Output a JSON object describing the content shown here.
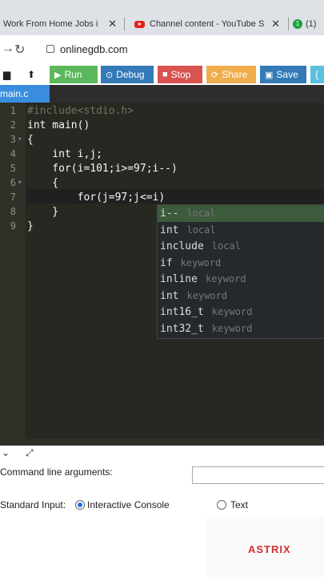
{
  "browser": {
    "tabs": [
      {
        "label": "Work From Home Jobs i"
      },
      {
        "label": "Channel content - YouTube S"
      },
      {
        "label": "(1)"
      }
    ],
    "url": "onlinegdb.com"
  },
  "toolbar": {
    "run": "Run",
    "debug": "Debug",
    "stop": "Stop",
    "share": "Share",
    "save": "Save",
    "extra": "{"
  },
  "file_tab": "main.c",
  "code_lines": [
    {
      "n": "1",
      "text": "#include<stdio.h>"
    },
    {
      "n": "2",
      "text": "int main()"
    },
    {
      "n": "3",
      "text": "{"
    },
    {
      "n": "4",
      "text": "    int i,j;"
    },
    {
      "n": "5",
      "text": "    for(i=101;i>=97;i--)"
    },
    {
      "n": "6",
      "text": "    {"
    },
    {
      "n": "7",
      "text": "        for(j=97;j<=i)"
    },
    {
      "n": "8",
      "text": "    }"
    },
    {
      "n": "9",
      "text": "}"
    }
  ],
  "autocomplete": [
    {
      "word": "i--",
      "meta": "local"
    },
    {
      "word": "int",
      "meta": "local"
    },
    {
      "word": "include",
      "meta": "local"
    },
    {
      "word": "if",
      "meta": "keyword"
    },
    {
      "word": "inline",
      "meta": "keyword"
    },
    {
      "word": "int",
      "meta": "keyword"
    },
    {
      "word": "int16_t",
      "meta": "keyword"
    },
    {
      "word": "int32_t",
      "meta": "keyword"
    }
  ],
  "bottom": {
    "cmd_args_label": "Command line arguments:",
    "stdin_label": "Standard Input:",
    "interactive_label": "Interactive Console",
    "text_label": "Text"
  },
  "watermark": "ASTRIX",
  "colors": {
    "run": "#5cb85c",
    "debug": "#337ab7",
    "stop": "#d9534f",
    "share": "#f0ad4e",
    "save": "#337ab7",
    "file_tab": "#3a8dde"
  }
}
